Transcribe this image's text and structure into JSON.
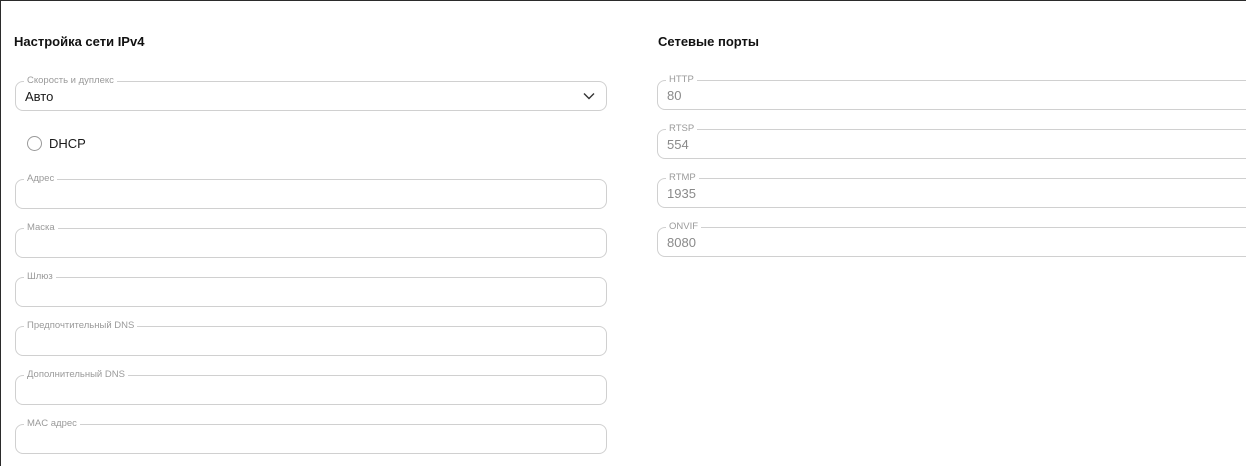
{
  "ipv4": {
    "title": "Настройка сети IPv4",
    "speed": {
      "label": "Скорость и дуплекс",
      "value": "Авто",
      "icon": "chevron-down-icon"
    },
    "dhcp": {
      "label": "DHCP",
      "checked": false
    },
    "address": {
      "label": "Адрес",
      "value": ""
    },
    "mask": {
      "label": "Маска",
      "value": ""
    },
    "gateway": {
      "label": "Шлюз",
      "value": ""
    },
    "dns_primary": {
      "label": "Предпочтительный DNS",
      "value": ""
    },
    "dns_secondary": {
      "label": "Дополнительный DNS",
      "value": ""
    },
    "mac": {
      "label": "MAC адрес",
      "value": ""
    }
  },
  "ports": {
    "title": "Сетевые порты",
    "http": {
      "label": "HTTP",
      "value": "80"
    },
    "rtsp": {
      "label": "RTSP",
      "value": "554"
    },
    "rtmp": {
      "label": "RTMP",
      "value": "1935"
    },
    "onvif": {
      "label": "ONVIF",
      "value": "8080"
    }
  }
}
